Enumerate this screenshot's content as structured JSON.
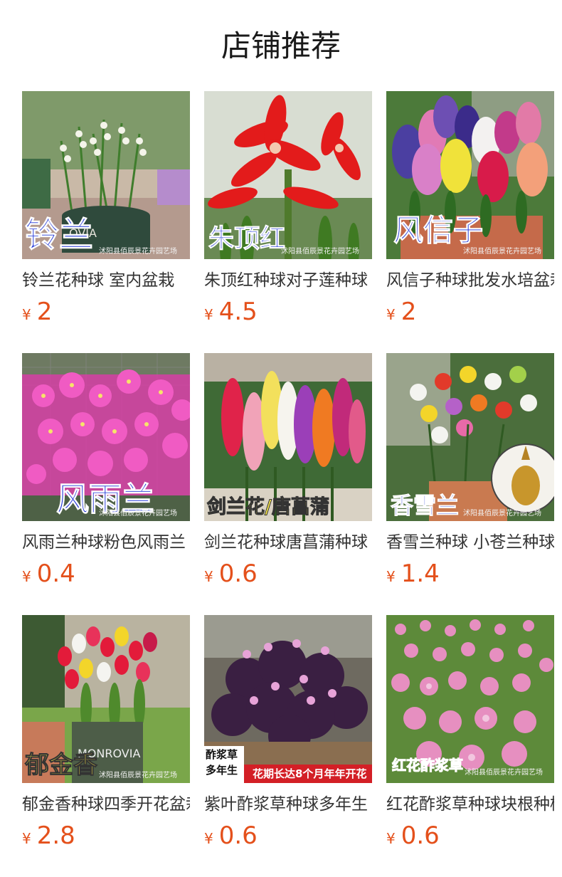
{
  "header": {
    "title": "店铺推荐"
  },
  "currency": "¥",
  "watermark": "沭阳县佰辰景花卉园艺场",
  "colors": {
    "price": "#e4501b",
    "title": "#1a1a1a",
    "name": "#333333"
  },
  "products": [
    {
      "name": "铃兰花种球 室内盆栽",
      "price": "2",
      "overlay": "铃兰"
    },
    {
      "name": "朱顶红种球对子莲种球",
      "price": "4.5",
      "overlay": "朱顶红"
    },
    {
      "name": "风信子种球批发水培盆栽",
      "price": "2",
      "overlay": "风信子"
    },
    {
      "name": "风雨兰种球粉色风雨兰",
      "price": "0.4",
      "overlay": "风雨兰"
    },
    {
      "name": "剑兰花种球唐菖蒲种球",
      "price": "0.6",
      "overlay": "剑兰花/唐菖蒲"
    },
    {
      "name": "香雪兰种球 小苍兰种球",
      "price": "1.4",
      "overlay": "香雪兰"
    },
    {
      "name": "郁金香种球四季开花盆栽",
      "price": "2.8",
      "overlay": "郁金香"
    },
    {
      "name": "紫叶酢浆草种球多年生",
      "price": "0.6",
      "overlay": "酢浆草",
      "overlay_2": "多年生",
      "banner": "花期长达8个月年年开花"
    },
    {
      "name": "红花酢浆草种球块根种植",
      "price": "0.6",
      "overlay": "红花酢浆草"
    }
  ]
}
